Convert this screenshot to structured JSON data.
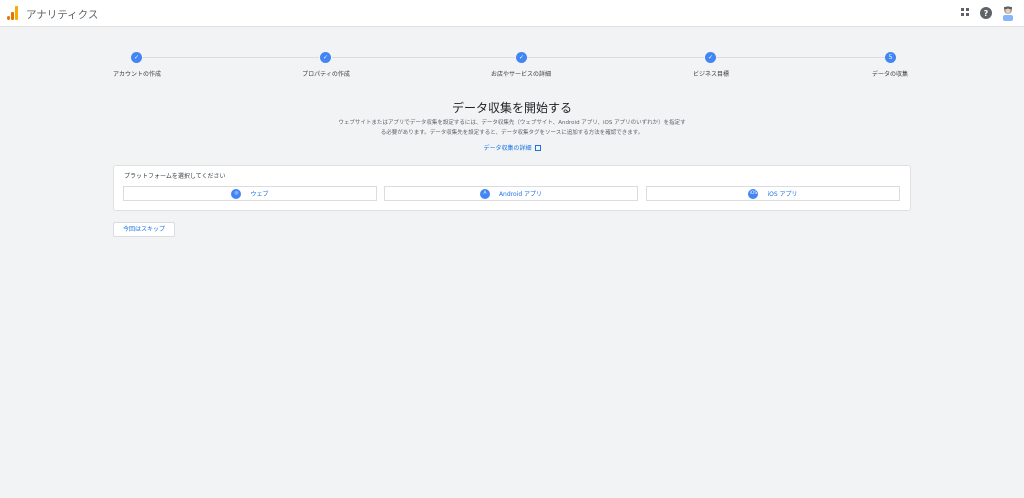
{
  "app": {
    "title": "アナリティクス",
    "logo_icon": "analytics-logo-icon",
    "colors": {
      "accent": "#1a73e8",
      "step": "#4285f4"
    }
  },
  "topbar": {
    "icons": [
      "apps-grid-icon",
      "help-icon",
      "avatar"
    ],
    "help_glyph": "?"
  },
  "stepper": {
    "steps": [
      {
        "label": "アカウントの作成",
        "state": "done",
        "marker": "✓"
      },
      {
        "label": "プロパティの作成",
        "state": "done",
        "marker": "✓"
      },
      {
        "label": "お店やサービスの詳細",
        "state": "done",
        "marker": "✓"
      },
      {
        "label": "ビジネス目標",
        "state": "done",
        "marker": "✓"
      },
      {
        "label": "データの収集",
        "state": "current",
        "marker": "5"
      }
    ]
  },
  "main": {
    "heading": "データ収集を開始する",
    "description": "ウェブサイトまたはアプリでデータ収集を設定するには、データ収集先（ウェブサイト、Android アプリ、iOS アプリのいずれか）を指定する必要があります。データ収集先を設定すると、データ収集タグをソースに追加する方法を確認できます。",
    "learn_more": "データ収集の詳細"
  },
  "platform": {
    "title": "プラットフォームを選択してください",
    "options": [
      {
        "label": "ウェブ",
        "icon": "globe-icon",
        "glyph": "◎"
      },
      {
        "label": "Android アプリ",
        "icon": "android-icon",
        "glyph": "A"
      },
      {
        "label": "iOS アプリ",
        "icon": "ios-icon",
        "glyph": "iOS"
      }
    ]
  },
  "actions": {
    "skip": "今回はスキップ"
  }
}
